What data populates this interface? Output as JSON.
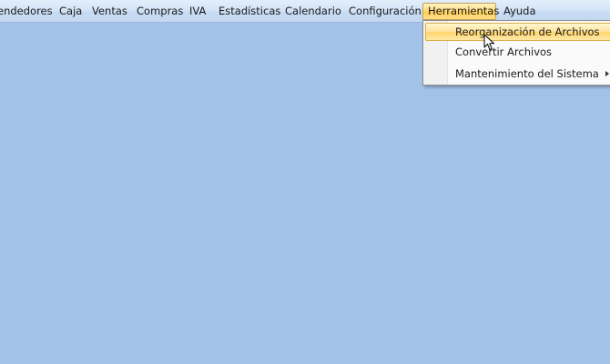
{
  "menubar": {
    "items": [
      {
        "label": "endedores"
      },
      {
        "label": "Caja"
      },
      {
        "label": "Ventas"
      },
      {
        "label": "Compras"
      },
      {
        "label": "IVA"
      },
      {
        "label": "Estadísticas"
      },
      {
        "label": "Calendario"
      },
      {
        "label": "Configuración"
      },
      {
        "label": "Herramientas"
      },
      {
        "label": "Ayuda"
      }
    ],
    "active_item": "Herramientas"
  },
  "dropdown": {
    "items": [
      {
        "label": "Reorganización de Archivos",
        "hovered": true
      },
      {
        "label": "Convertir Archivos"
      },
      {
        "label": "Mantenimiento del Sistema",
        "has_submenu": true
      }
    ]
  },
  "colors": {
    "desktop_background": "#a3c2e8",
    "menubar_background": "#d4e4f7",
    "highlight": "#ffd875"
  },
  "icons": {
    "cursor": "arrow-cursor-icon",
    "submenu": "submenu-arrow-icon"
  }
}
